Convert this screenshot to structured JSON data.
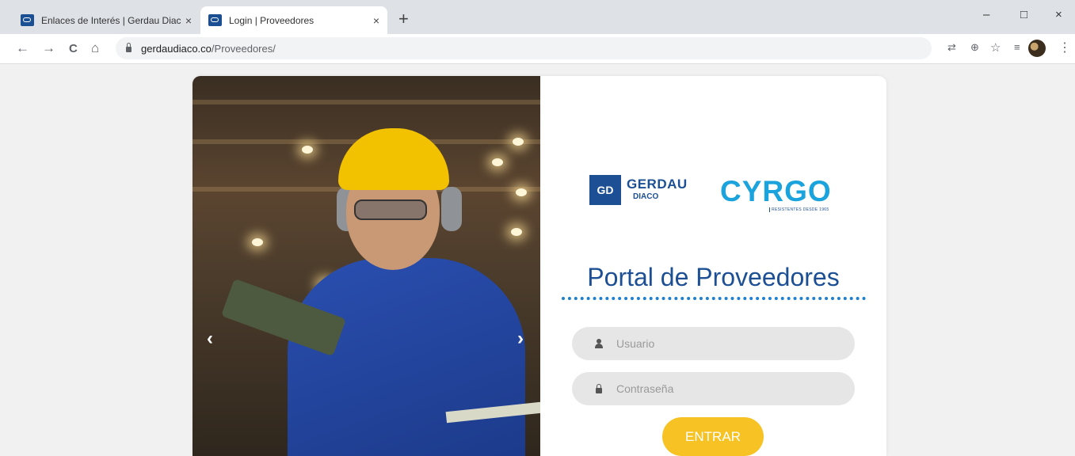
{
  "browser": {
    "tabs": [
      {
        "title": "Enlaces de Interés | Gerdau Diaco",
        "close": "×"
      },
      {
        "title": "Login | Proveedores",
        "close": "×"
      }
    ],
    "new_tab": "+",
    "window_controls": {
      "minimize": "–",
      "maximize": "□",
      "close": "×"
    },
    "nav": {
      "back": "←",
      "forward": "→",
      "reload": "C",
      "home": "⌂"
    },
    "address": {
      "domain": "gerdaudiaco.co",
      "path": "/Proveedores/"
    },
    "extension_icons": [
      "translate-icon",
      "zoom-icon",
      "star-icon",
      "reading-list-icon"
    ],
    "menu": "⋮"
  },
  "carousel": {
    "prev": "‹",
    "next": "›"
  },
  "logos": {
    "gerdau_mark": "GD",
    "gerdau_name": "GERDAU",
    "gerdau_sub": "DIACO",
    "cyrgo_name": "CYRGO",
    "cyrgo_tagline": "RESISTENTES DESDE 1965"
  },
  "login": {
    "title": "Portal de Proveedores",
    "username_placeholder": "Usuario",
    "password_placeholder": "Contraseña",
    "submit_label": "ENTRAR"
  },
  "colors": {
    "brand_blue": "#1c4f94",
    "cyrgo_blue": "#1aa3dc",
    "button_yellow": "#f6c224"
  }
}
